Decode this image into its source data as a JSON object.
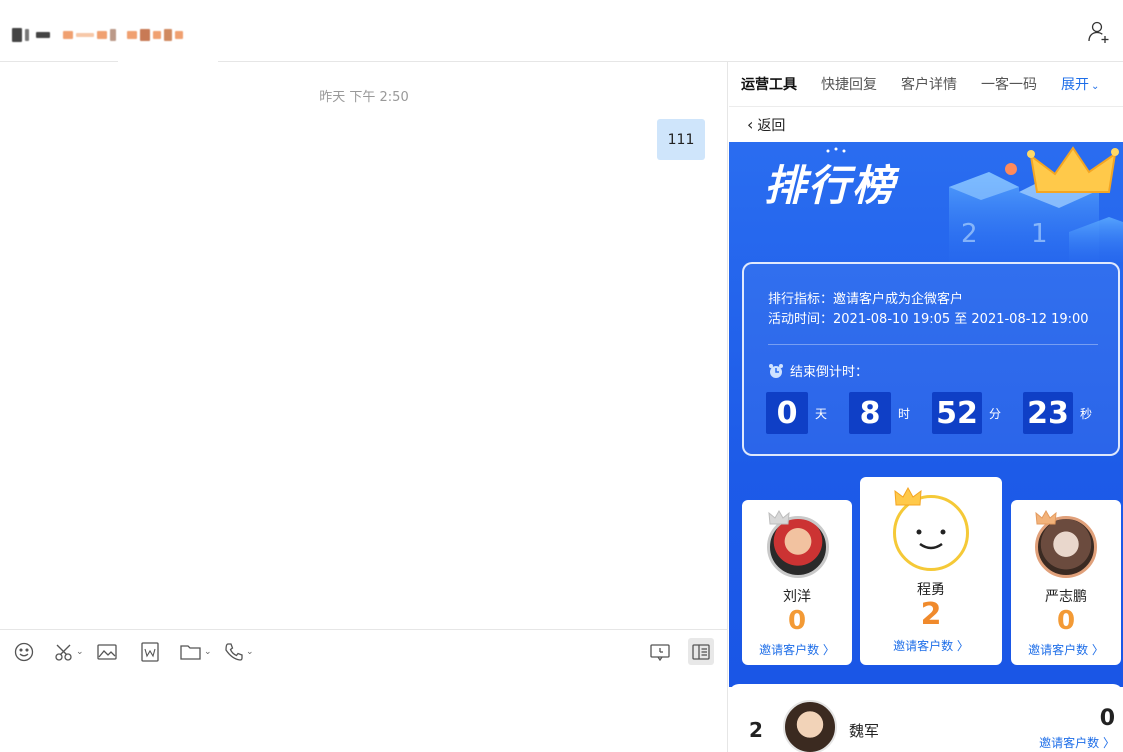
{
  "header": {
    "add_contact_icon": "add-contact-icon"
  },
  "chat": {
    "timestamp": "昨天 下午 2:50",
    "messages": [
      {
        "text": "111",
        "side": "right"
      }
    ]
  },
  "toolbar": {
    "tools": [
      "emoji-icon",
      "scissors-icon",
      "image-icon",
      "word-doc-icon",
      "folder-icon",
      "phone-icon"
    ],
    "right_tools": [
      "chat-record-icon",
      "sidebar-panel-icon"
    ]
  },
  "panel": {
    "tabs": [
      {
        "label": "运营工具",
        "active": true
      },
      {
        "label": "快捷回复",
        "active": false
      },
      {
        "label": "客户详情",
        "active": false
      },
      {
        "label": "一客一码",
        "active": false
      }
    ],
    "expand_label": "展开",
    "back_label": "返回",
    "hero_title": "排行榜",
    "info": {
      "metric_line": "排行指标：邀请客户成为企微客户",
      "time_line": "活动时间：2021-08-10 19:05 至 2021-08-12 19:00",
      "countdown_label": "结束倒计时：",
      "countdown": {
        "days": "0",
        "days_unit": "天",
        "hours": "8",
        "hours_unit": "时",
        "minutes": "52",
        "minutes_unit": "分",
        "seconds": "23",
        "seconds_unit": "秒"
      }
    },
    "podium": {
      "second": {
        "name": "刘洋",
        "count": "0",
        "link": "邀请客户数 〉"
      },
      "first": {
        "name": "程勇",
        "count": "2",
        "link": "邀请客户数 〉"
      },
      "third": {
        "name": "严志鹏",
        "count": "0",
        "link": "邀请客户数 〉"
      }
    },
    "list": [
      {
        "rank": "2",
        "name": "魏军",
        "count": "0",
        "link": "邀请客户数 〉"
      }
    ]
  },
  "colors": {
    "accent": "#1e6ee8",
    "hero_blue": "#1d5be8",
    "countdown_box": "#0f3fc6",
    "gold_count": "#f39a35",
    "bubble": "#cfe5fb"
  }
}
